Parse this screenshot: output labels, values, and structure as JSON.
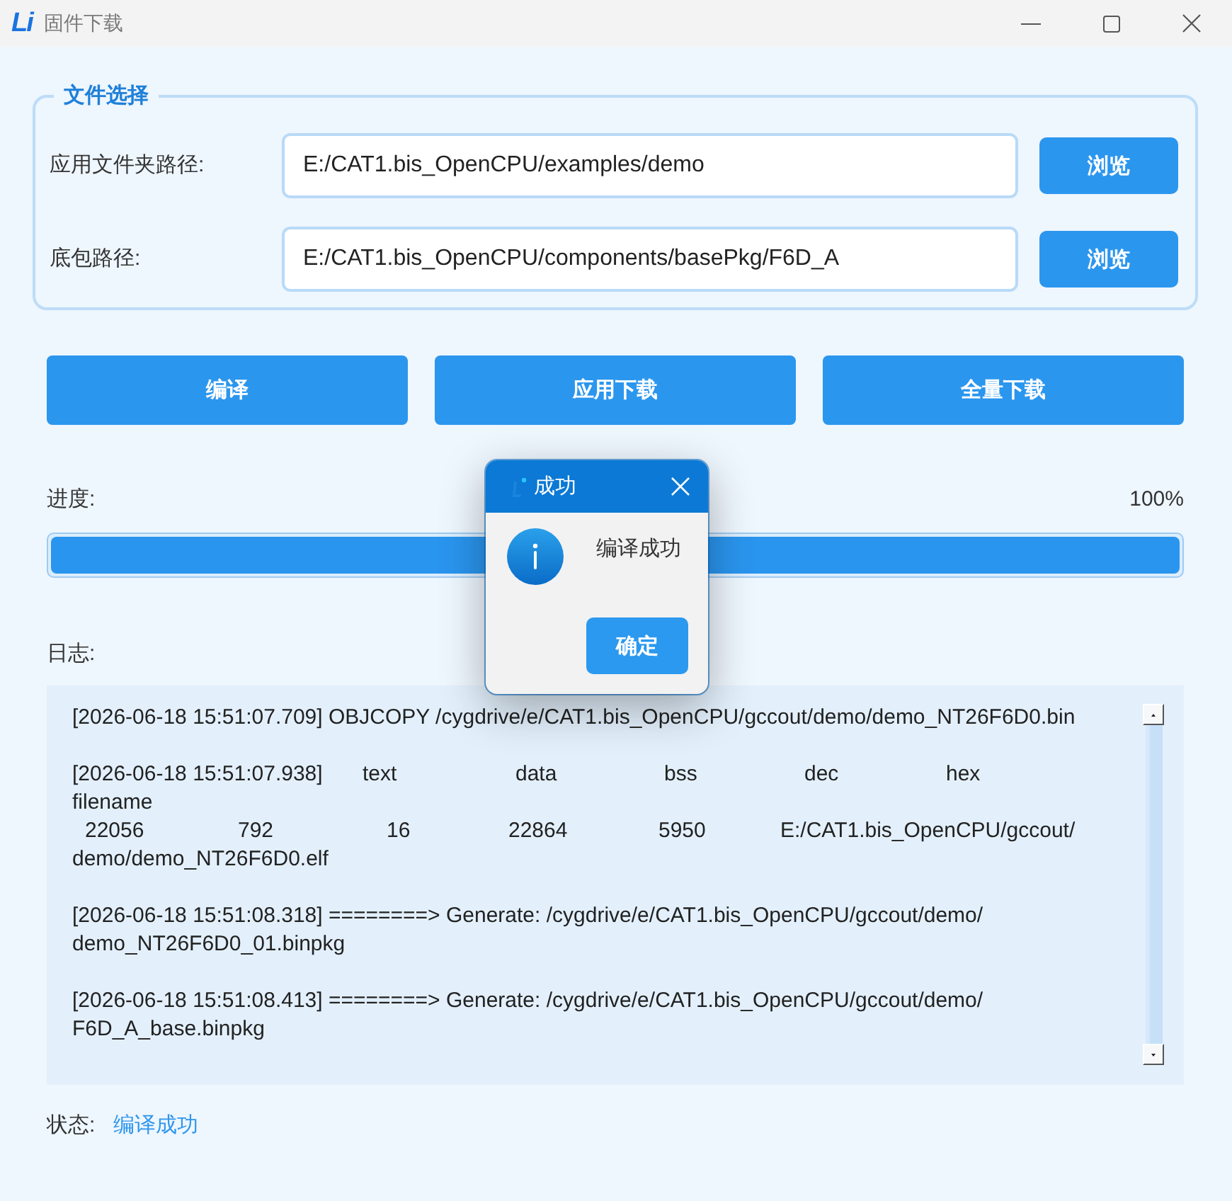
{
  "window": {
    "logo": "Li",
    "title": "固件下载"
  },
  "file_selection": {
    "title": "文件选择",
    "rows": [
      {
        "label": "应用文件夹路径:",
        "value": "E:/CAT1.bis_OpenCPU/examples/demo",
        "button": "浏览"
      },
      {
        "label": "底包路径:",
        "value": "E:/CAT1.bis_OpenCPU/components/basePkg/F6D_A",
        "button": "浏览"
      }
    ]
  },
  "actions": [
    "编译",
    "应用下载",
    "全量下载"
  ],
  "progress": {
    "label": "进度:",
    "reading": "100%",
    "level": 1
  },
  "log": {
    "label": "日志:",
    "entries": [
      {
        "lines": [
          {
            "kind": "text",
            "text": "[2026-06-18 15:51:07.709] OBJCOPY /cygdrive/e/CAT1.bis_OpenCPU/gccout/demo/demo_NT26F6D0.bin"
          }
        ]
      },
      {
        "lines": [
          {
            "kind": "columns",
            "cells": [
              "[2026-06-18 15:51:07.938]",
              "text",
              "data",
              "bss",
              "dec",
              "hex"
            ]
          },
          {
            "kind": "text",
            "text": "filename"
          },
          {
            "kind": "columns",
            "cells": [
              "22056",
              "792",
              "16",
              "22864",
              "5950",
              "E:/CAT1.bis_OpenCPU/gccout/"
            ]
          },
          {
            "kind": "text",
            "text": "demo/demo_NT26F6D0.elf"
          }
        ]
      },
      {
        "lines": [
          {
            "kind": "text",
            "text": "[2026-06-18 15:51:08.318] ========> Generate: /cygdrive/e/CAT1.bis_OpenCPU/gccout/demo/"
          },
          {
            "kind": "text",
            "text": "demo_NT26F6D0_01.binpkg"
          }
        ]
      },
      {
        "lines": [
          {
            "kind": "text",
            "text": "[2026-06-18 15:51:08.413] ========> Generate: /cygdrive/e/CAT1.bis_OpenCPU/gccout/demo/"
          },
          {
            "kind": "text",
            "text": "F6D_A_base.binpkg"
          }
        ]
      }
    ]
  },
  "status": {
    "label": "状态:",
    "value": "编译成功"
  },
  "dialog": {
    "title": "成功",
    "message": "编译成功",
    "button": "确定"
  }
}
